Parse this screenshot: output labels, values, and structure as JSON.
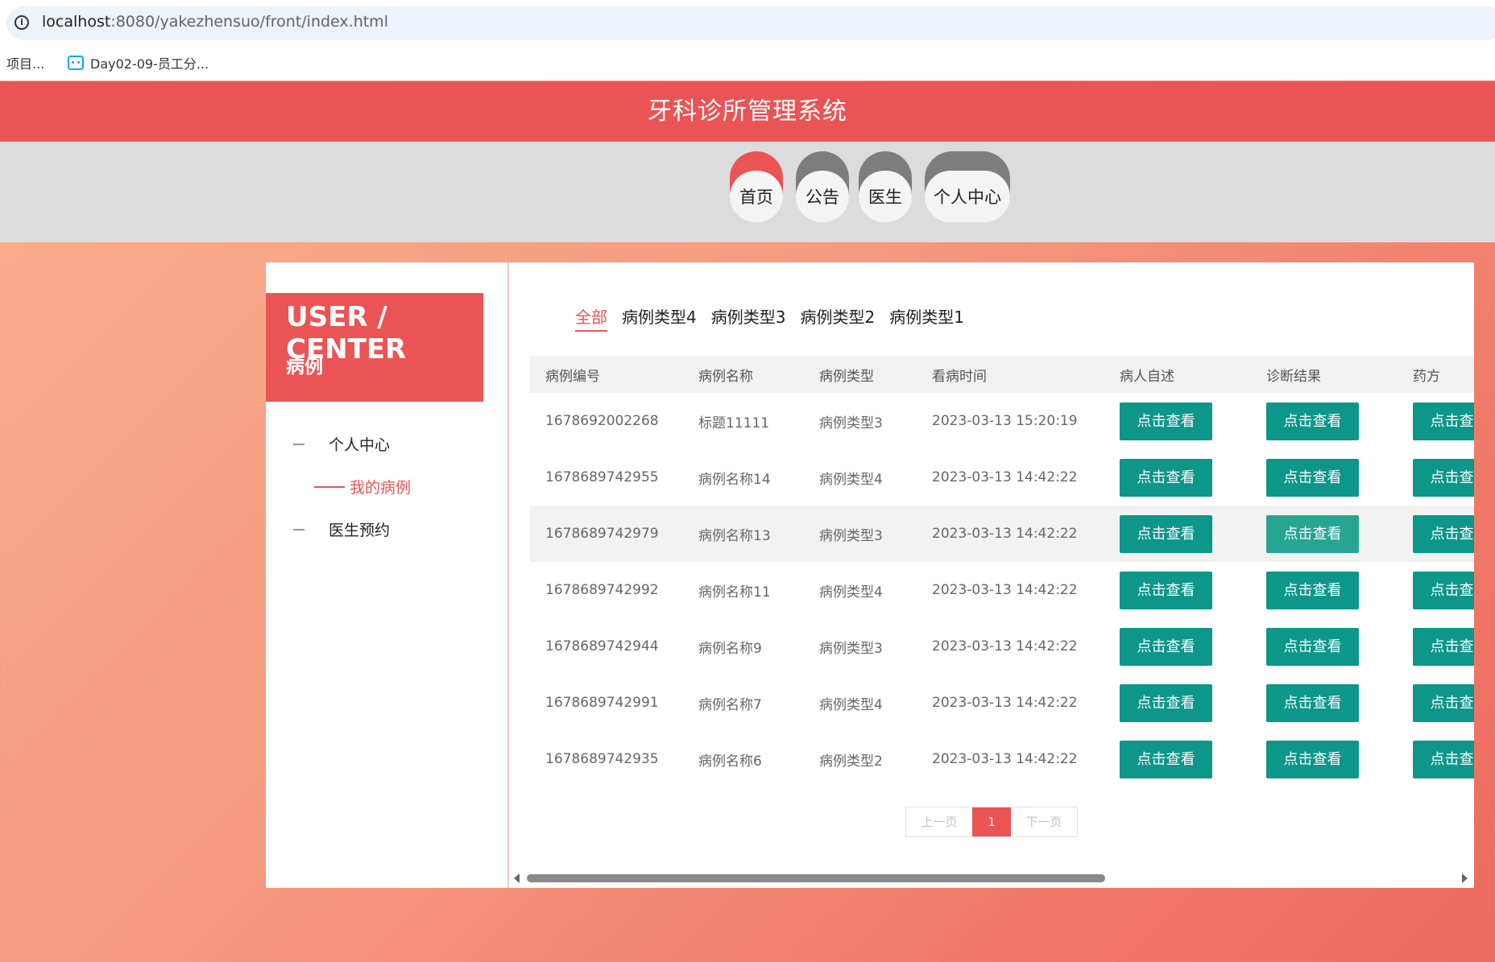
{
  "browser": {
    "url_host": "localhost",
    "url_path": ":8080/yakezhensuo/front/index.html",
    "bookmarks": [
      "项目...",
      "Day02-09-员工分..."
    ]
  },
  "site": {
    "title": "牙科诊所管理系统",
    "nav": [
      "首页",
      "公告",
      "医生",
      "个人中心"
    ]
  },
  "sidebar": {
    "title": "USER / CENTER",
    "subtitle": "病例",
    "items": [
      "个人中心",
      "我的病例",
      "医生预约"
    ]
  },
  "tabs": [
    "全部",
    "病例类型4",
    "病例类型3",
    "病例类型2",
    "病例类型1"
  ],
  "table": {
    "headers": [
      "病例编号",
      "病例名称",
      "病例类型",
      "看病时间",
      "病人自述",
      "诊断结果",
      "药方"
    ],
    "button_label": "点击查看",
    "rows": [
      [
        "1678692002268",
        "标题11111",
        "病例类型3",
        "2023-03-13 15:20:19"
      ],
      [
        "1678689742955",
        "病例名称14",
        "病例类型4",
        "2023-03-13 14:42:22"
      ],
      [
        "1678689742979",
        "病例名称13",
        "病例类型3",
        "2023-03-13 14:42:22"
      ],
      [
        "1678689742992",
        "病例名称11",
        "病例类型4",
        "2023-03-13 14:42:22"
      ],
      [
        "1678689742944",
        "病例名称9",
        "病例类型3",
        "2023-03-13 14:42:22"
      ],
      [
        "1678689742991",
        "病例名称7",
        "病例类型4",
        "2023-03-13 14:42:22"
      ],
      [
        "1678689742935",
        "病例名称6",
        "病例类型2",
        "2023-03-13 14:42:22"
      ]
    ]
  },
  "pager": {
    "prev": "上一页",
    "current": "1",
    "next": "下一页"
  },
  "colors": {
    "brand": "#ea5455",
    "button": "#0d968a"
  }
}
